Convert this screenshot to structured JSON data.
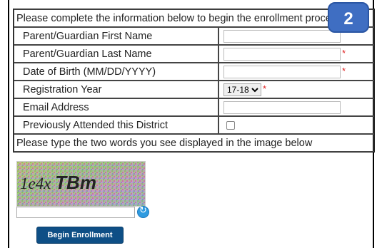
{
  "header": {
    "text": "Please complete the information below to begin the enrollment process."
  },
  "badge": {
    "number": "2"
  },
  "fields": {
    "first_name": {
      "label": "Parent/Guardian First Name",
      "value": ""
    },
    "last_name": {
      "label": "Parent/Guardian Last Name",
      "value": "",
      "required_mark": "*"
    },
    "dob": {
      "label": "Date of Birth (MM/DD/YYYY)",
      "value": "",
      "required_mark": "*"
    },
    "registration_year": {
      "label": "Registration Year",
      "selected": "17-18",
      "required_mark": "*"
    },
    "email": {
      "label": "Email Address",
      "value": ""
    },
    "previously_attended": {
      "label": "Previously Attended this District",
      "checked": false
    }
  },
  "captcha": {
    "instruction": "Please type the two words you see displayed in the image below",
    "image_text_a": "1e4x",
    "image_text_b": "TBm",
    "input_value": ""
  },
  "submit": {
    "label": "Begin Enrollment"
  },
  "colors": {
    "badge": "#3f6ec2",
    "button": "#0e4f86",
    "required": "#e02020"
  }
}
